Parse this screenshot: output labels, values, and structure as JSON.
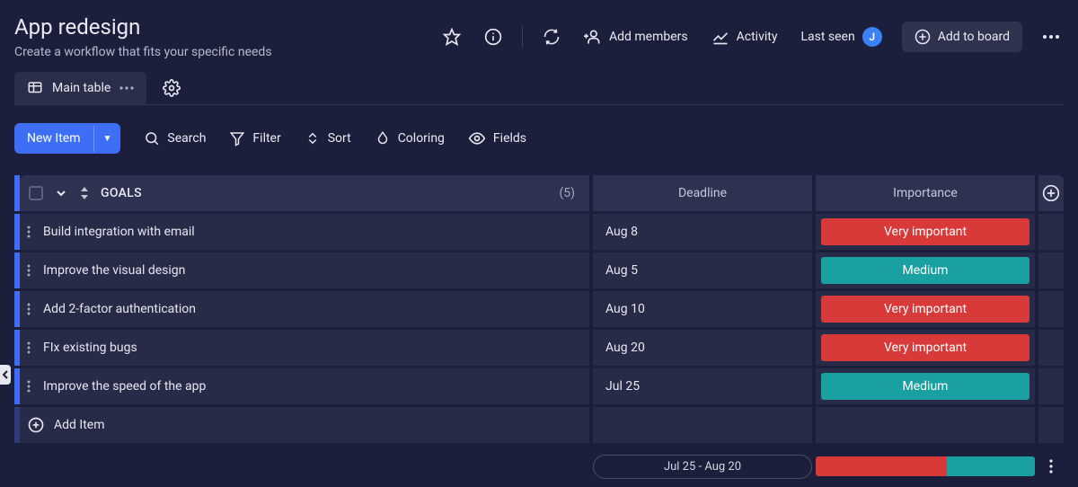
{
  "header": {
    "title": "App redesign",
    "subtitle": "Create a workflow that fits your specific needs",
    "add_members": "Add members",
    "activity": "Activity",
    "last_seen": "Last seen",
    "avatar_initial": "J",
    "add_to_board": "Add to board"
  },
  "tabs": {
    "main": "Main table"
  },
  "toolbar": {
    "new_item": "New Item",
    "search": "Search",
    "filter": "Filter",
    "sort": "Sort",
    "coloring": "Coloring",
    "fields": "Fields"
  },
  "group": {
    "name": "GOALS",
    "count": "(5)",
    "columns": {
      "deadline": "Deadline",
      "importance": "Importance"
    },
    "rows": [
      {
        "name": "Build integration with email",
        "deadline": "Aug 8",
        "importance": "Very important",
        "importance_level": "very"
      },
      {
        "name": "Improve the visual design",
        "deadline": "Aug 5",
        "importance": "Medium",
        "importance_level": "medium"
      },
      {
        "name": "Add 2-factor authentication",
        "deadline": "Aug 10",
        "importance": "Very important",
        "importance_level": "very"
      },
      {
        "name": "FIx existing bugs",
        "deadline": "Aug 20",
        "importance": "Very important",
        "importance_level": "very"
      },
      {
        "name": "Improve the speed of the app",
        "deadline": "Jul 25",
        "importance": "Medium",
        "importance_level": "medium"
      }
    ],
    "add_item": "Add Item",
    "summary": {
      "date_range": "Jul 25 - Aug 20",
      "very_pct": 60,
      "medium_pct": 40
    }
  },
  "colors": {
    "very_important": "#d83a3a",
    "medium": "#1aa0a0",
    "accent": "#3f6ef6"
  }
}
